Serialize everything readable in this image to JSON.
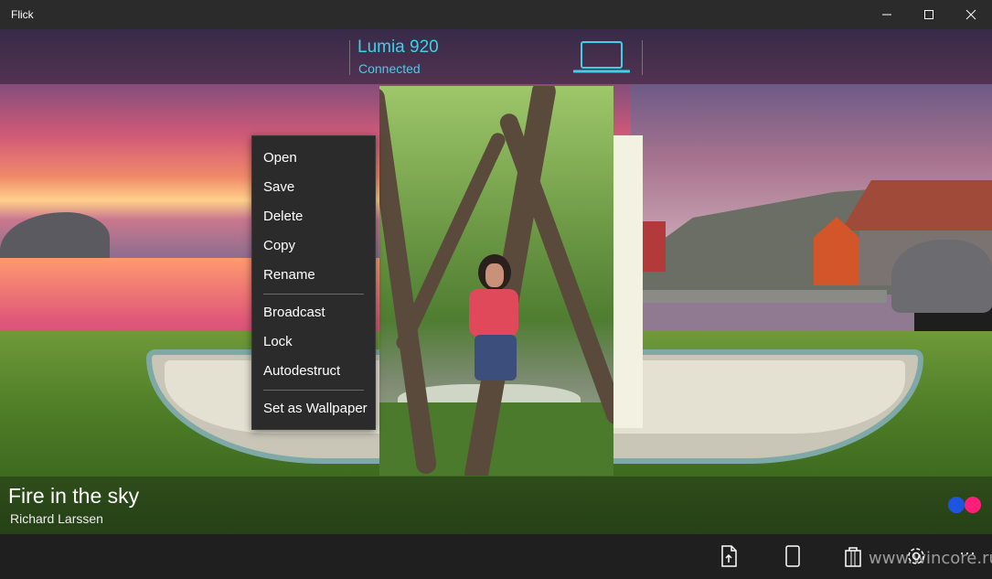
{
  "window": {
    "title": "Flick",
    "minimize_glyph": "—",
    "maximize_glyph": "☐",
    "close_glyph": "✕"
  },
  "device": {
    "name": "Lumia 920",
    "status": "Connected",
    "icon": "laptop-icon",
    "accent": "#3fd0e8"
  },
  "photo": {
    "title": "Fire in the sky",
    "author": "Richard Larssen",
    "source_logo": "flickr-logo",
    "logo_colors": [
      "#1e55e0",
      "#ff1f7a"
    ]
  },
  "context_menu": {
    "items": [
      "Open",
      "Save",
      "Delete",
      "Copy",
      "Rename",
      "Broadcast",
      "Lock",
      "Autodestruct",
      "Set as Wallpaper"
    ]
  },
  "command_bar": {
    "buttons": [
      "share-icon",
      "phone-icon",
      "bag-icon",
      "gear-icon",
      "more-icon"
    ],
    "more_glyph": "···",
    "watermark": "www.wincore.ru"
  }
}
